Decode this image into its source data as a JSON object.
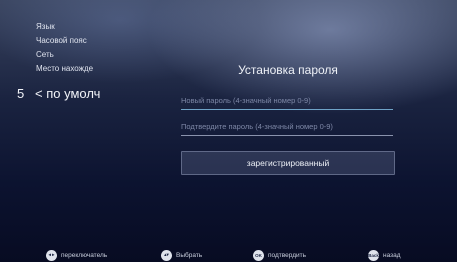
{
  "sidebar": {
    "items": [
      {
        "label": "Язык"
      },
      {
        "label": "Часовой пояс"
      },
      {
        "label": "Сеть"
      },
      {
        "label": "Место нахожде"
      }
    ],
    "selected_number": "5",
    "selected_label": "< по умолч"
  },
  "panel": {
    "title": "Установка пароля",
    "new_password_placeholder": "Новый пароль (4-значный номер 0-9)",
    "confirm_password_placeholder": "Подтвердите пароль (4-значный номер 0-9)",
    "register_button": "зарегистрированный"
  },
  "footer": {
    "hints": [
      {
        "icon": "left-right-arrows-icon",
        "glyph": "◂ ▸",
        "label": "переключатель"
      },
      {
        "icon": "up-down-arrows-icon",
        "glyph": "▴▾",
        "label": "Выбрать"
      },
      {
        "icon": "ok-button-icon",
        "glyph": "OK",
        "label": "подтвердить"
      },
      {
        "icon": "back-button-icon",
        "glyph": "Back",
        "label": "назад"
      }
    ]
  }
}
